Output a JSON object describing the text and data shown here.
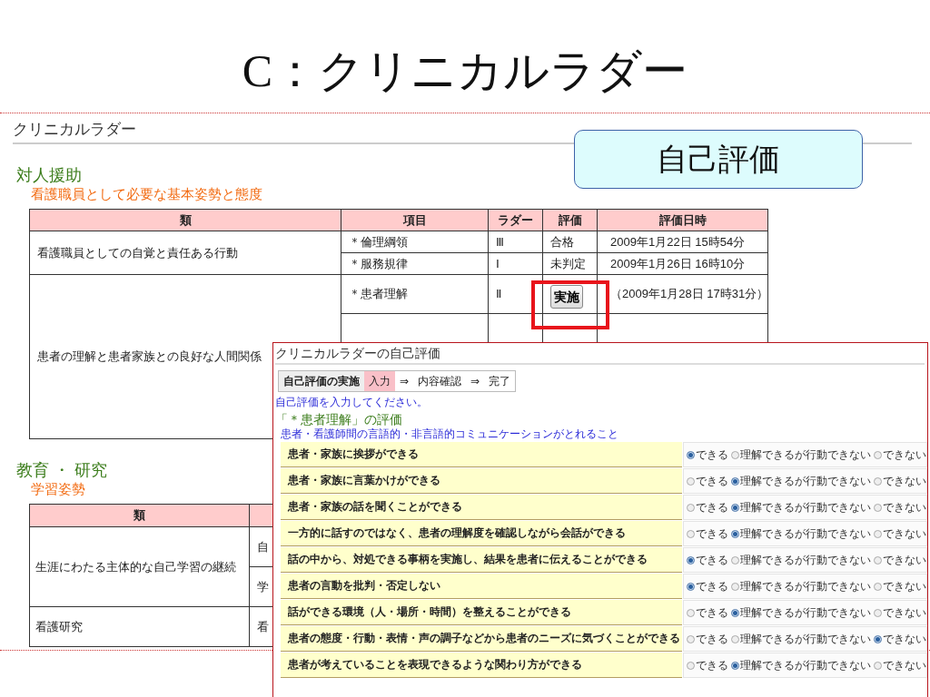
{
  "slide_title": "C：クリニカルラダー",
  "callout": "自己評価",
  "page": {
    "title": "クリニカルラダー",
    "sections": [
      {
        "heading": "対人援助",
        "subheading": "看護職員として必要な基本姿勢と態度",
        "columns": [
          "類",
          "項目",
          "ラダー",
          "評価",
          "評価日時"
        ],
        "groups": [
          {
            "category": "看護職員としての自覚と責任ある行動",
            "items": [
              {
                "item": "＊倫理綱領",
                "ladder": "Ⅲ",
                "evaluation": {
                  "kind": "text",
                  "label": "合格"
                },
                "date": "2009年1月22日 15時54分"
              },
              {
                "item": "＊服務規律",
                "ladder": "Ⅰ",
                "evaluation": {
                  "kind": "text",
                  "label": "未判定"
                },
                "date": "2009年1月26日 16時10分"
              }
            ]
          },
          {
            "category": "患者の理解と患者家族との良好な人間関係",
            "items": [
              {
                "item": "＊患者理解",
                "ladder": "Ⅱ",
                "evaluation": {
                  "kind": "button",
                  "label": "実施"
                },
                "date": "（2009年1月28日 17時31分）"
              }
            ]
          }
        ]
      },
      {
        "heading": "教育 ・ 研究",
        "subheading": "学習姿勢",
        "columns": [
          "類"
        ],
        "groups": [
          {
            "category": "生涯にわたる主体的な自己学習の継続",
            "items": [
              {
                "item": "自"
              },
              {
                "item": "学"
              }
            ]
          },
          {
            "category": "看護研究",
            "items": [
              {
                "item": "看"
              }
            ]
          }
        ]
      }
    ]
  },
  "dialog": {
    "title": "クリニカルラダーの自己評価",
    "steps": [
      {
        "kind": "title",
        "label": "自己評価の実施"
      },
      {
        "kind": "step",
        "label": "入力",
        "selected": true
      },
      {
        "kind": "arrow",
        "label": "⇒"
      },
      {
        "kind": "step",
        "label": "内容確認",
        "selected": false
      },
      {
        "kind": "arrow",
        "label": "⇒"
      },
      {
        "kind": "step",
        "label": "完了",
        "selected": false
      }
    ],
    "instruction": "自己評価を入力してください。",
    "heading": "「＊患者理解」の評価",
    "subheading": "患者・看護師間の言語的・非言語的コミュニケーションがとれること",
    "questions": [
      {
        "text": "患者・家族に挨拶ができる",
        "options": [
          {
            "label": "できる",
            "selected": true
          },
          {
            "label": "理解できるが行動できない",
            "selected": false
          },
          {
            "label": "できない",
            "selected": false
          }
        ]
      },
      {
        "text": "患者・家族に言葉かけができる",
        "options": [
          {
            "label": "できる",
            "selected": false
          },
          {
            "label": "理解できるが行動できない",
            "selected": true
          },
          {
            "label": "できない",
            "selected": false
          }
        ]
      },
      {
        "text": "患者・家族の話を聞くことができる",
        "options": [
          {
            "label": "できる",
            "selected": false
          },
          {
            "label": "理解できるが行動できない",
            "selected": true
          },
          {
            "label": "できない",
            "selected": false
          }
        ]
      },
      {
        "text": "一方的に話すのではなく、患者の理解度を確認しながら会話ができる",
        "options": [
          {
            "label": "できる",
            "selected": false
          },
          {
            "label": "理解できるが行動できない",
            "selected": true
          },
          {
            "label": "できない",
            "selected": false
          }
        ]
      },
      {
        "text": "話の中から、対処できる事柄を実施し、結果を患者に伝えることができる",
        "options": [
          {
            "label": "できる",
            "selected": true
          },
          {
            "label": "理解できるが行動できない",
            "selected": false
          },
          {
            "label": "できない",
            "selected": false
          }
        ]
      },
      {
        "text": "患者の言動を批判・否定しない",
        "options": [
          {
            "label": "できる",
            "selected": true
          },
          {
            "label": "理解できるが行動できない",
            "selected": false
          },
          {
            "label": "できない",
            "selected": false
          }
        ]
      },
      {
        "text": "話ができる環境（人・場所・時間）を整えることができる",
        "options": [
          {
            "label": "できる",
            "selected": false
          },
          {
            "label": "理解できるが行動できない",
            "selected": true
          },
          {
            "label": "できない",
            "selected": false
          }
        ]
      },
      {
        "text": "患者の態度・行動・表情・声の調子などから患者のニーズに気づくことができる",
        "options": [
          {
            "label": "できる",
            "selected": false
          },
          {
            "label": "理解できるが行動できない",
            "selected": false
          },
          {
            "label": "できない",
            "selected": true
          }
        ]
      },
      {
        "text": "患者が考えていることを表現できるような関わり方ができる",
        "options": [
          {
            "label": "できる",
            "selected": false
          },
          {
            "label": "理解できるが行動できない",
            "selected": true
          },
          {
            "label": "できない",
            "selected": false
          }
        ]
      }
    ]
  }
}
